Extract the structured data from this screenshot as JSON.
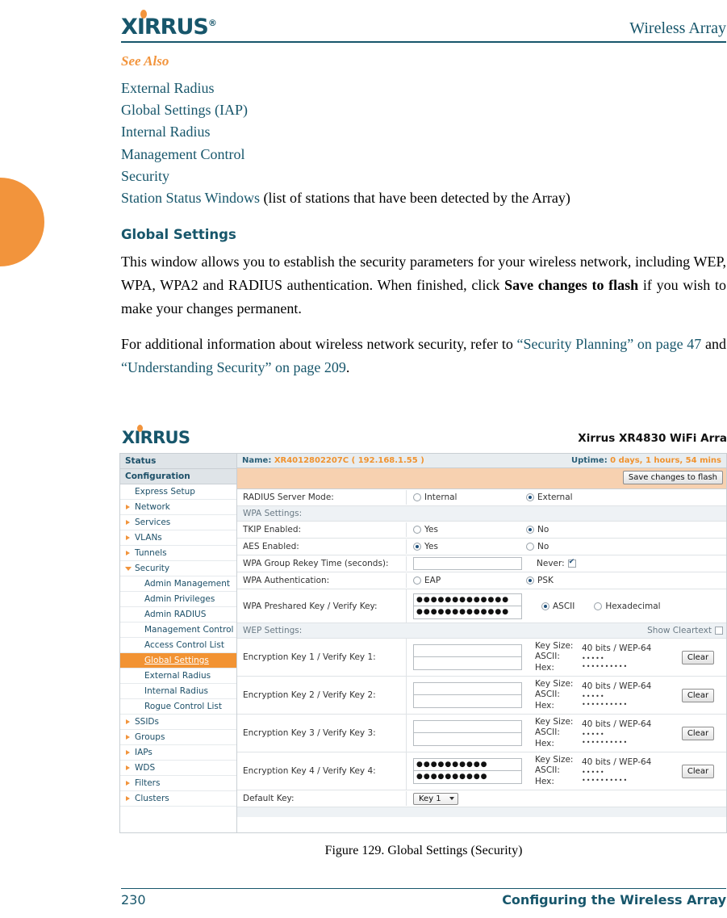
{
  "header": {
    "logo": "XIRRUS",
    "logo_reg": "®",
    "title": "Wireless Array"
  },
  "see_also": {
    "heading": "See Also",
    "links": [
      "External Radius",
      "Global Settings (IAP)",
      "Internal Radius",
      "Management Control",
      "Security",
      "Station Status Windows"
    ],
    "last_suffix": " (list of stations that have been detected by the Array)"
  },
  "section": {
    "title": "Global Settings",
    "para1_a": "This window allows you to establish the security parameters for your wireless network, including WEP, WPA, WPA2 and RADIUS authentication. When finished, click ",
    "para1_b": "Save changes to flash",
    "para1_c": " if you wish to make your changes permanent.",
    "para2_a": "For additional information about wireless network security, refer to ",
    "para2_link1": "“Security Planning” on page 47",
    "para2_mid": " and ",
    "para2_link2": "“Understanding Security” on page 209",
    "para2_end": "."
  },
  "screenshot": {
    "logo": "XIRRUS",
    "device_title": "Xirrus XR4830 WiFi Arra",
    "statusbar": {
      "name_label": "Name:",
      "name_value": "XR4012802207C",
      "name_ip": "( 192.168.1.55 )",
      "uptime_label": "Uptime:",
      "uptime_value": "0 days, 1 hours, 54 mins"
    },
    "save_button": "Save changes to flash",
    "sidebar": [
      {
        "label": "Status",
        "level": "head",
        "arrow": "none",
        "selected": false
      },
      {
        "label": "Configuration",
        "level": "head",
        "arrow": "none",
        "selected": false
      },
      {
        "label": "Express Setup",
        "level": "plain",
        "arrow": "none",
        "selected": false
      },
      {
        "label": "Network",
        "level": "l1",
        "arrow": "right",
        "selected": false
      },
      {
        "label": "Services",
        "level": "l1",
        "arrow": "right",
        "selected": false
      },
      {
        "label": "VLANs",
        "level": "l1",
        "arrow": "right",
        "selected": false
      },
      {
        "label": "Tunnels",
        "level": "l1",
        "arrow": "right",
        "selected": false
      },
      {
        "label": "Security",
        "level": "l1",
        "arrow": "down",
        "selected": false
      },
      {
        "label": "Admin Management",
        "level": "l2",
        "arrow": "none",
        "selected": false
      },
      {
        "label": "Admin Privileges",
        "level": "l2",
        "arrow": "none",
        "selected": false
      },
      {
        "label": "Admin RADIUS",
        "level": "l2",
        "arrow": "none",
        "selected": false
      },
      {
        "label": "Management Control",
        "level": "l2",
        "arrow": "none",
        "selected": false
      },
      {
        "label": "Access Control List",
        "level": "l2",
        "arrow": "none",
        "selected": false
      },
      {
        "label": "Global Settings",
        "level": "l2",
        "arrow": "none",
        "selected": true
      },
      {
        "label": "External Radius",
        "level": "l2",
        "arrow": "none",
        "selected": false
      },
      {
        "label": "Internal Radius",
        "level": "l2",
        "arrow": "none",
        "selected": false
      },
      {
        "label": "Rogue Control List",
        "level": "l2",
        "arrow": "none",
        "selected": false
      },
      {
        "label": "SSIDs",
        "level": "l1",
        "arrow": "right",
        "selected": false
      },
      {
        "label": "Groups",
        "level": "l1",
        "arrow": "right",
        "selected": false
      },
      {
        "label": "IAPs",
        "level": "l1",
        "arrow": "right",
        "selected": false
      },
      {
        "label": "WDS",
        "level": "l1",
        "arrow": "right",
        "selected": false
      },
      {
        "label": "Filters",
        "level": "l1",
        "arrow": "right",
        "selected": false
      },
      {
        "label": "Clusters",
        "level": "l1",
        "arrow": "right",
        "selected": false
      }
    ],
    "radius_mode": {
      "label": "RADIUS Server Mode:",
      "option1": "Internal",
      "option2": "External",
      "selected": "External"
    },
    "wpa_header": "WPA Settings:",
    "tkip": {
      "label": "TKIP Enabled:",
      "yes": "Yes",
      "no": "No",
      "selected": "No"
    },
    "aes": {
      "label": "AES Enabled:",
      "yes": "Yes",
      "no": "No",
      "selected": "Yes"
    },
    "rekey": {
      "label": "WPA Group Rekey Time (seconds):",
      "value": "",
      "never_label": "Never:",
      "never_checked": true
    },
    "wpa_auth": {
      "label": "WPA Authentication:",
      "eap": "EAP",
      "psk": "PSK",
      "selected": "PSK"
    },
    "wpa_psk": {
      "label": "WPA Preshared Key / Verify Key:",
      "key": "●●●●●●●●●●●●●",
      "verify": "●●●●●●●●●●●●●",
      "ascii": "ASCII",
      "hex": "Hexadecimal",
      "selected": "ASCII"
    },
    "wep_header": "WEP Settings:",
    "show_cleartext": "Show Cleartext",
    "show_cleartext_checked": false,
    "wep_meta": {
      "key_size": "Key Size:",
      "ascii": "ASCII:",
      "hex": "Hex:"
    },
    "wep_keys": [
      {
        "label": "Encryption Key 1 / Verify Key 1:",
        "key": "",
        "verify": "",
        "key_size_val": "40 bits / WEP-64",
        "ascii_val": "•••••",
        "hex_val": "••••••••••",
        "clear": "Clear"
      },
      {
        "label": "Encryption Key 2 / Verify Key 2:",
        "key": "",
        "verify": "",
        "key_size_val": "40 bits / WEP-64",
        "ascii_val": "•••••",
        "hex_val": "••••••••••",
        "clear": "Clear"
      },
      {
        "label": "Encryption Key 3 / Verify Key 3:",
        "key": "",
        "verify": "",
        "key_size_val": "40 bits / WEP-64",
        "ascii_val": "•••••",
        "hex_val": "••••••••••",
        "clear": "Clear"
      },
      {
        "label": "Encryption Key 4 / Verify Key 4:",
        "key": "●●●●●●●●●●",
        "verify": "●●●●●●●●●●",
        "key_size_val": "40 bits / WEP-64",
        "ascii_val": "•••••",
        "hex_val": "••••••••••",
        "clear": "Clear"
      }
    ],
    "default_key": {
      "label": "Default Key:",
      "value": "Key 1"
    }
  },
  "figure_caption": "Figure 129. Global Settings (Security)",
  "footer": {
    "page": "230",
    "title": "Configuring the Wireless Array"
  },
  "colors": {
    "brand_blue": "#17566b",
    "brand_orange": "#f2943c",
    "selected_nav": "#f29333",
    "save_bar": "#f7d1b0"
  }
}
